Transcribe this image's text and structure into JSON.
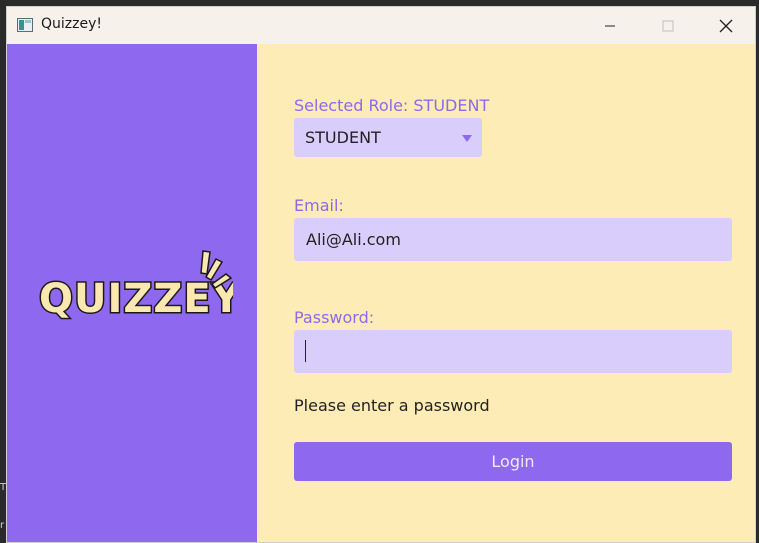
{
  "window": {
    "title": "Quizzey!",
    "logo_text": "QUIZZEY"
  },
  "colors": {
    "accent": "#8f68f0",
    "panel_bg": "#fdecb5",
    "input_bg": "#d9cdfb",
    "logo_fill": "#fbe7b0"
  },
  "form": {
    "role_label": "Selected Role: STUDENT",
    "role_selected": "STUDENT",
    "email_label": "Email:",
    "email_value": "Ali@Ali.com",
    "password_label": "Password:",
    "password_value": "",
    "error_message": "Please enter a password",
    "login_label": "Login"
  },
  "background": {
    "fragment_1": "T",
    "fragment_2": "r"
  }
}
